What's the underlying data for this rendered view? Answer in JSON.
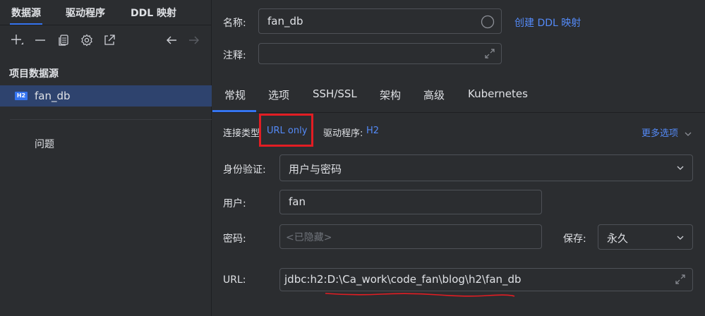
{
  "left_panel": {
    "tabs": [
      {
        "label": "数据源"
      },
      {
        "label": "驱动程序"
      },
      {
        "label": "DDL 映射"
      }
    ],
    "section_title": "项目数据源",
    "datasource": {
      "badge": "H2",
      "name": "fan_db"
    },
    "problems_label": "问题"
  },
  "form": {
    "name_label": "名称:",
    "name_value": "fan_db",
    "create_ddl_link": "创建 DDL 映射",
    "comment_label": "注释:",
    "comment_value": "",
    "tabs": [
      {
        "label": "常规"
      },
      {
        "label": "选项"
      },
      {
        "label": "SSH/SSL"
      },
      {
        "label": "架构"
      },
      {
        "label": "高级"
      },
      {
        "label": "Kubernetes"
      }
    ],
    "conn_type_label": "连接类型",
    "conn_type_value": "URL only",
    "driver_label": "驱动程序:",
    "driver_value": "H2",
    "more_options": "更多选项",
    "auth_label": "身份验证:",
    "auth_value": "用户与密码",
    "user_label": "用户:",
    "user_value": "fan",
    "password_label": "密码:",
    "password_placeholder": "<已隐藏>",
    "save_label": "保存:",
    "save_value": "永久",
    "url_label": "URL:",
    "url_value": "jdbc:h2:D:\\Ca_work\\code_fan\\blog\\h2\\fan_db"
  },
  "colors": {
    "background": "#2b2d30",
    "selection": "#2e436e",
    "accent": "#3574f0",
    "link": "#548af7",
    "annotation_red": "#e21d23"
  }
}
